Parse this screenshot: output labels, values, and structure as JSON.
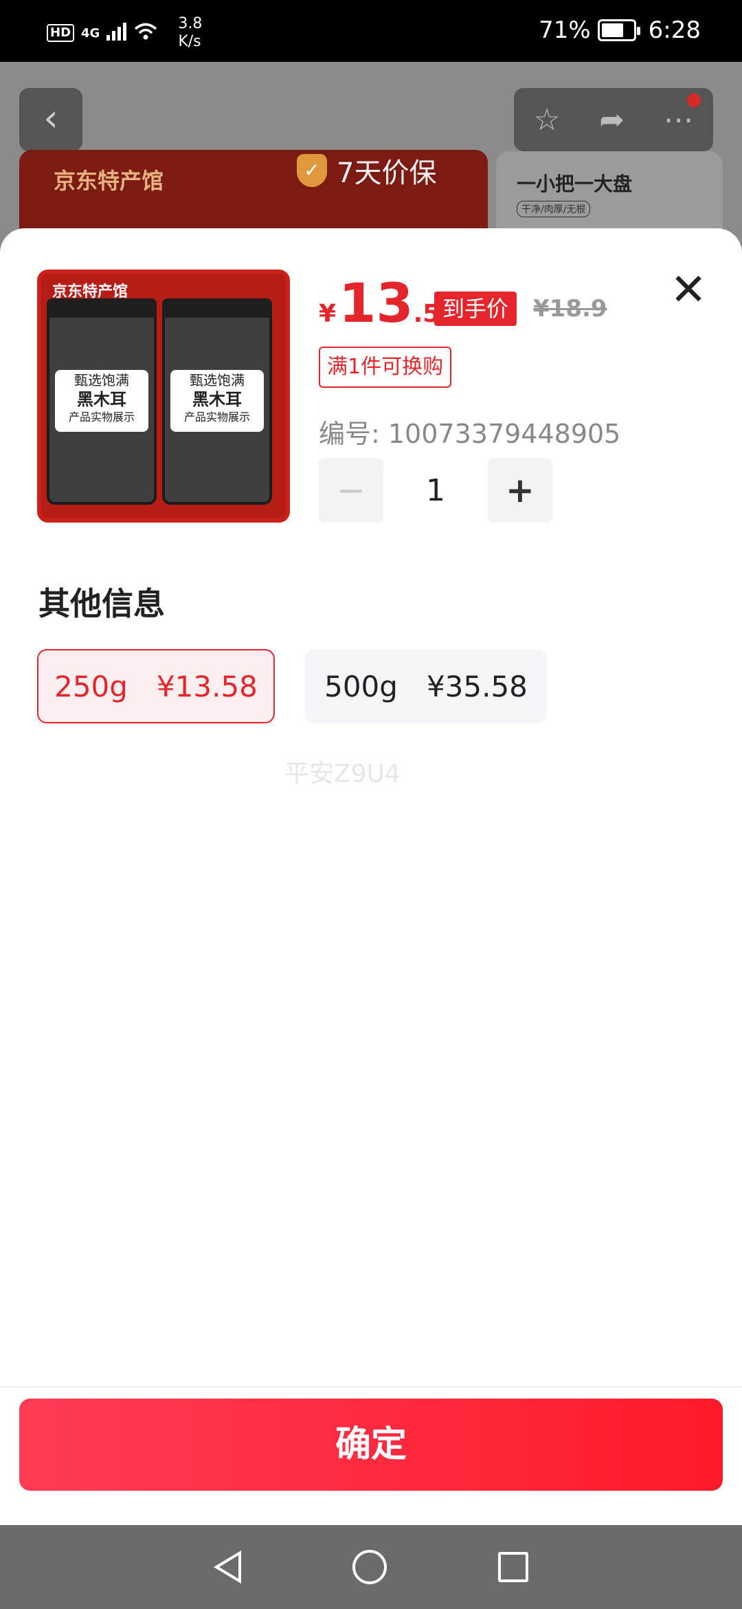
{
  "status_bar": {
    "hd": "HD",
    "net": "4G",
    "speed_value": "3.8",
    "speed_unit": "K/s",
    "battery": "71%",
    "battery_level": 0.71,
    "time": "6:28"
  },
  "background_page": {
    "store_name": "京东特产馆",
    "price_guarantee": "7天价保",
    "side_card_title": "一小把一大盘",
    "side_card_sub": "干净/肉厚/无根"
  },
  "product": {
    "image_logo": "京东特产馆",
    "jar_label_line1": "甄选饱满",
    "jar_label_line2": "黑木耳",
    "jar_label_line3": "产品实物展示",
    "price_currency": "¥",
    "price_int": "13",
    "price_dec": ".58",
    "price_tag": "到手价",
    "original_price": "¥18.9",
    "promo": "满1件可换购",
    "sku": "编号: 10073379448905",
    "quantity": "1",
    "minus": "−",
    "plus": "+"
  },
  "options_section": {
    "title": "其他信息",
    "options": [
      {
        "weight": "250g",
        "price": "¥13.58",
        "selected": true
      },
      {
        "weight": "500g",
        "price": "¥35.58",
        "selected": false
      }
    ]
  },
  "watermark": "平安Z9U4",
  "confirm_label": "确定",
  "close_glyph": "✕",
  "colors": {
    "accent": "#e4262c",
    "confirm_start": "#ff3b55",
    "confirm_end": "#ff1a2b"
  }
}
